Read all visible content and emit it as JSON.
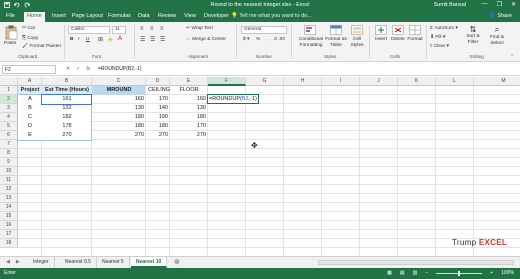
{
  "window": {
    "title": "Round to the nearest Integer.xlsx - Excel",
    "user": "Sumit Bansal",
    "minimize": "—",
    "restore": "❐",
    "close": "✕"
  },
  "tabs": [
    "File",
    "Home",
    "Insert",
    "Page Layout",
    "Formulas",
    "Data",
    "Review",
    "View",
    "Developer"
  ],
  "active_tab": "Home",
  "tell_me": "Tell me what you want to do...",
  "share": "Share",
  "ribbon": {
    "paste": "Paste",
    "cut": "Cut",
    "copy": "Copy",
    "format_painter": "Format Painter",
    "clipboard": "Clipboard",
    "font_name": "Calibri",
    "font_size": "11",
    "font": "Font",
    "wrap_text": "Wrap Text",
    "merge_center": "Merge & Center",
    "alignment": "Alignment",
    "number_format": "General",
    "number": "Number",
    "conditional_formatting": "Conditional Formatting",
    "format_as_table": "Format as Table",
    "cell_styles": "Cell Styles",
    "styles": "Styles",
    "insert": "Insert",
    "delete": "Delete",
    "format": "Format",
    "cells": "Cells",
    "autosum": "AutoSum",
    "fill": "Fill",
    "clear": "Clear",
    "sort_filter": "Sort & Filter",
    "find_select": "Find & Select",
    "editing": "Editing"
  },
  "formula_bar": {
    "name_box": "F2",
    "cancel": "✕",
    "enter": "✓",
    "fx": "fx",
    "formula": "=ROUNDUP(B2,-1)"
  },
  "columns": [
    "A",
    "B",
    "C",
    "D",
    "E",
    "F",
    "G",
    "H",
    "I",
    "J",
    "K",
    "L",
    "M"
  ],
  "rows": [
    "1",
    "2",
    "3",
    "4",
    "5",
    "6",
    "7",
    "8",
    "9",
    "10",
    "11",
    "12",
    "13",
    "14",
    "15",
    "16",
    "17",
    "18"
  ],
  "table": {
    "headers": [
      "Project",
      "Est Time (Hours)",
      "MROUND",
      "CEILING",
      "FLOOR"
    ],
    "rows": [
      [
        "A",
        "161",
        "160",
        "170",
        "160"
      ],
      [
        "B",
        "132",
        "130",
        "140",
        "130"
      ],
      [
        "C",
        "182",
        "180",
        "190",
        "180"
      ],
      [
        "D",
        "178",
        "180",
        "180",
        "170"
      ],
      [
        "E",
        "270",
        "270",
        "270",
        "270"
      ]
    ],
    "editing_cell": {
      "prefix": "=ROUNDUP(",
      "ref": "B2",
      "suffix": ",-1)"
    }
  },
  "logo": {
    "part1": "Trump ",
    "part2": "EXCEL"
  },
  "sheets": [
    "Integer",
    "Nearest 0.5",
    "Nearest 5",
    "Nearest 10"
  ],
  "active_sheet": "Nearest 10",
  "status": {
    "mode": "Enter",
    "zoom": "100%"
  },
  "colors": {
    "excel_green": "#217346",
    "header_fill": "#bdd7ee",
    "row_highlight": "#ddebf7",
    "logo_accent": "#c23b22"
  }
}
